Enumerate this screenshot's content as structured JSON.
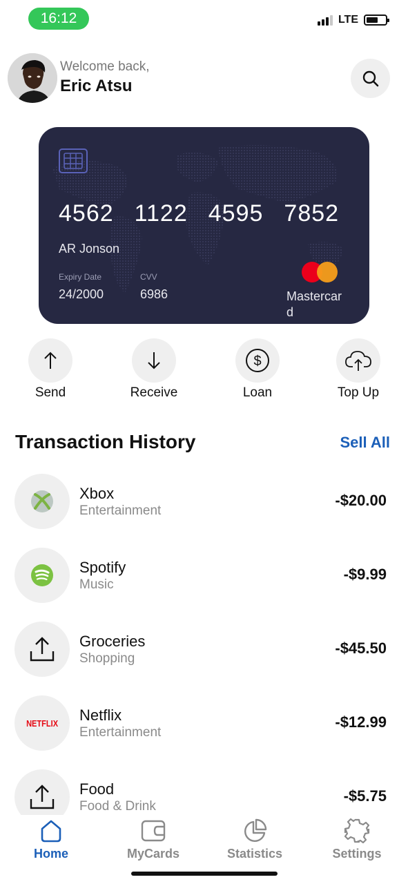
{
  "status_bar": {
    "time": "16:12",
    "network": "LTE",
    "time_pill_color": "#34c759"
  },
  "header": {
    "welcome": "Welcome back,",
    "user_name": "Eric Atsu",
    "avatar_icon": "user-avatar",
    "search_icon": "search-icon"
  },
  "card": {
    "number_groups": [
      "4562",
      "1122",
      "4595",
      "7852"
    ],
    "holder": "AR Jonson",
    "expiry_label": "Expiry Date",
    "expiry_value": "24/2000",
    "cvv_label": "CVV",
    "cvv_value": "6986",
    "network_name": "Mastercard",
    "background_color": "#262842"
  },
  "actions": [
    {
      "label": "Send",
      "icon": "arrow-up-icon"
    },
    {
      "label": "Receive",
      "icon": "arrow-down-icon"
    },
    {
      "label": "Loan",
      "icon": "dollar-circle-icon"
    },
    {
      "label": "Top Up",
      "icon": "cloud-upload-icon"
    }
  ],
  "transactions": {
    "title": "Transaction History",
    "see_all": "Sell All",
    "accent_color": "#1b5fb8",
    "items": [
      {
        "name": "Xbox",
        "category": "Entertainment",
        "amount": "-$20.00",
        "icon": "xbox-icon"
      },
      {
        "name": "Spotify",
        "category": "Music",
        "amount": "-$9.99",
        "icon": "spotify-icon"
      },
      {
        "name": "Groceries",
        "category": "Shopping",
        "amount": "-$45.50",
        "icon": "upload-icon"
      },
      {
        "name": "Netflix",
        "category": "Entertainment",
        "amount": "-$12.99",
        "icon": "netflix-icon",
        "logo_text": "NETFLIX"
      },
      {
        "name": "Food",
        "category": "Food & Drink",
        "amount": "-$5.75",
        "icon": "upload-icon"
      }
    ]
  },
  "bottom_nav": {
    "active": "Home",
    "items": [
      {
        "label": "Home",
        "icon": "home-icon"
      },
      {
        "label": "MyCards",
        "icon": "wallet-icon"
      },
      {
        "label": "Statistics",
        "icon": "pie-chart-icon"
      },
      {
        "label": "Settings",
        "icon": "gear-icon"
      }
    ]
  }
}
